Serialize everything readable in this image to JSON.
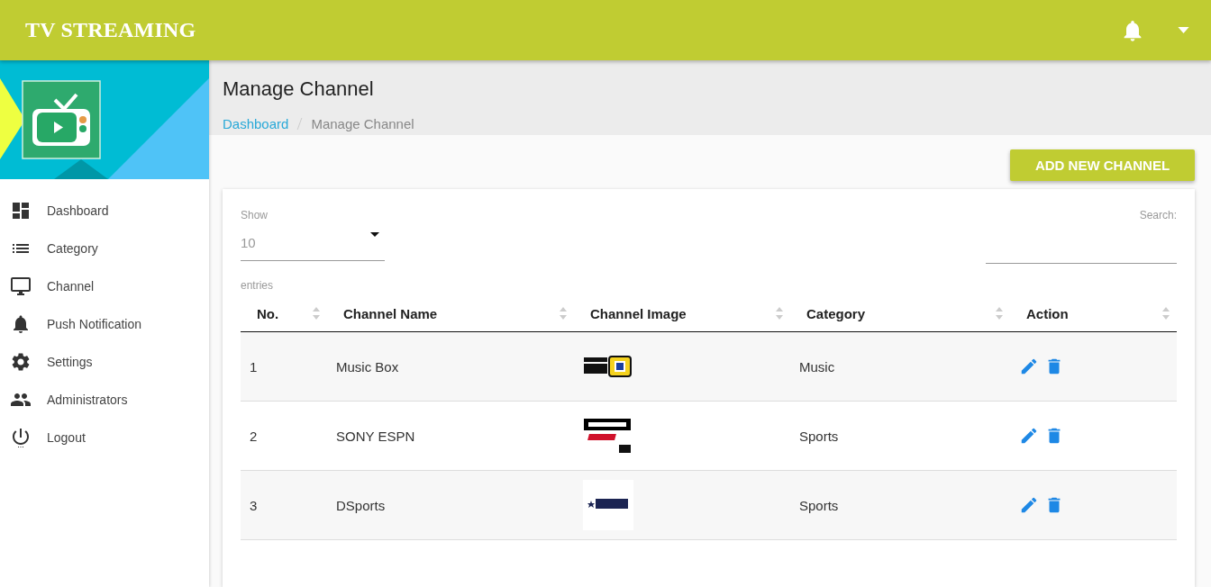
{
  "header": {
    "title": "TV STREAMING"
  },
  "sidebar": {
    "items": [
      {
        "label": "Dashboard"
      },
      {
        "label": "Category"
      },
      {
        "label": "Channel"
      },
      {
        "label": "Push Notification"
      },
      {
        "label": "Settings"
      },
      {
        "label": "Administrators"
      },
      {
        "label": "Logout"
      }
    ]
  },
  "page": {
    "title": "Manage Channel",
    "breadcrumb": [
      {
        "label": "Dashboard",
        "kind": "link"
      },
      {
        "label": "Manage Channel",
        "kind": "current"
      }
    ]
  },
  "add_button": "ADD NEW CHANNEL",
  "table_controls": {
    "show_label": "Show",
    "page_size": "10",
    "entries_label": "entries",
    "search_label": "Search:"
  },
  "table": {
    "columns": [
      "No.",
      "Channel Name",
      "Channel Image",
      "Category",
      "Action"
    ],
    "rows": [
      {
        "no": "1",
        "name": "Music Box",
        "category": "Music"
      },
      {
        "no": "2",
        "name": "SONY ESPN",
        "category": "Sports"
      },
      {
        "no": "3",
        "name": "DSports",
        "category": "Sports"
      }
    ]
  }
}
